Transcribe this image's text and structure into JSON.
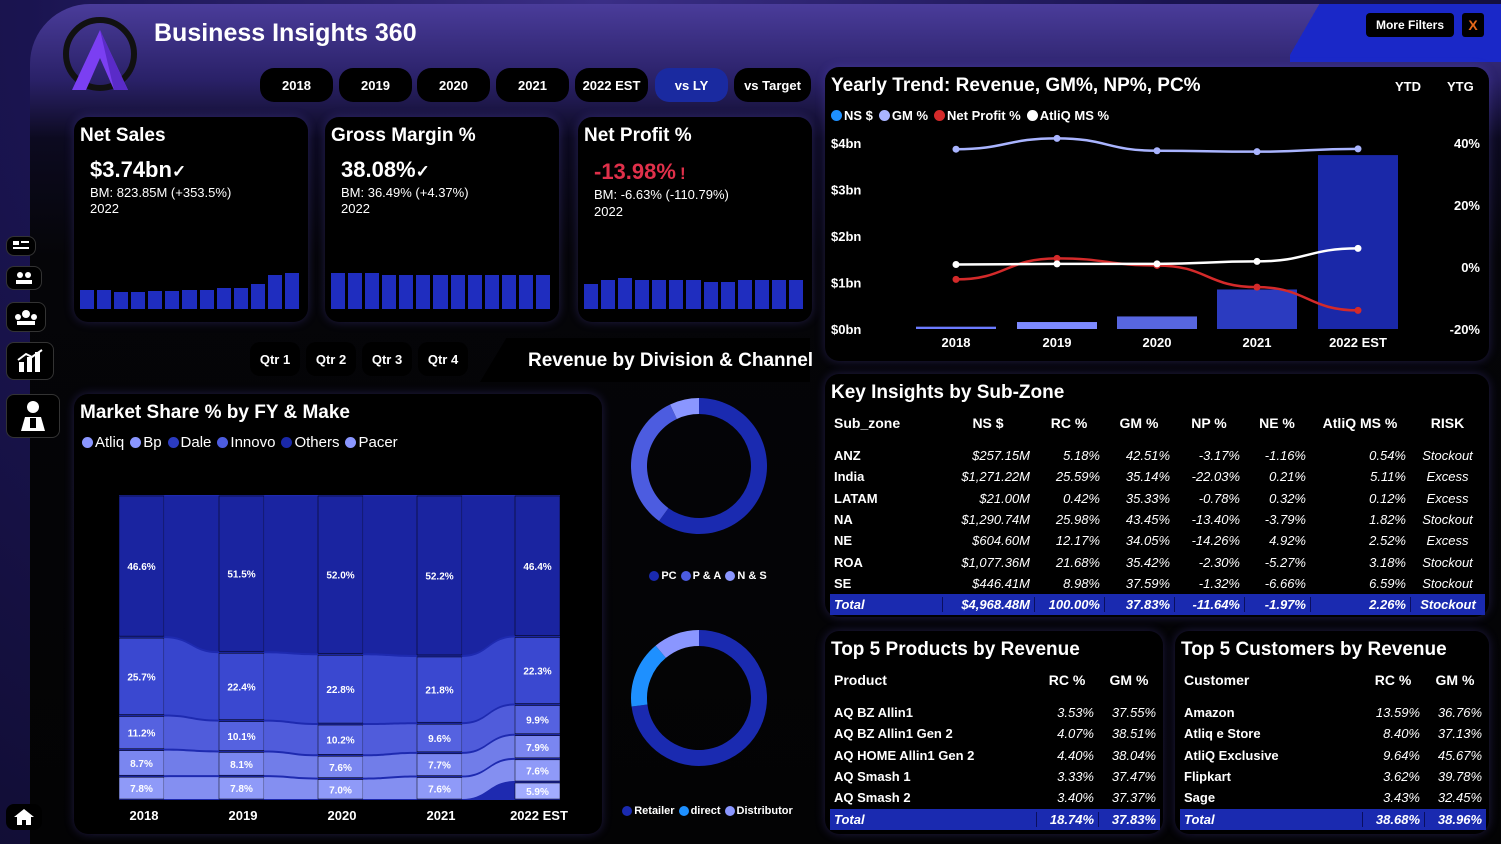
{
  "app": {
    "title": "Business Insights 360"
  },
  "header": {
    "more_filters": "More Filters",
    "close": "X"
  },
  "years": [
    "2018",
    "2019",
    "2020",
    "2021",
    "2022 EST"
  ],
  "compare": {
    "vs_ly": "vs LY",
    "vs_target": "vs Target"
  },
  "quarters": [
    "Qtr 1",
    "Qtr 2",
    "Qtr 3",
    "Qtr 4"
  ],
  "kpis": {
    "net_sales": {
      "title": "Net Sales",
      "value": "$3.74bn",
      "mark": "✓",
      "bm": "BM: 823.85M (+353.5%)",
      "year": "2022",
      "bars": [
        0.45,
        0.45,
        0.4,
        0.4,
        0.42,
        0.42,
        0.45,
        0.45,
        0.5,
        0.5,
        0.6,
        0.8,
        0.85
      ]
    },
    "gross_margin": {
      "title": "Gross Margin %",
      "value": "38.08%",
      "mark": "✓",
      "bm": "BM: 36.49% (+4.37%)",
      "year": "2022",
      "bars": [
        0.85,
        0.85,
        0.85,
        0.82,
        0.82,
        0.82,
        0.82,
        0.82,
        0.82,
        0.82,
        0.82,
        0.82,
        0.82
      ]
    },
    "net_profit": {
      "title": "Net Profit %",
      "value": "-13.98%",
      "mark": "!",
      "bm": "BM: -6.63% (-110.79%)",
      "year": "2022",
      "bars": [
        0.6,
        0.7,
        0.75,
        0.7,
        0.7,
        0.7,
        0.7,
        0.65,
        0.65,
        0.7,
        0.7,
        0.7,
        0.7
      ]
    }
  },
  "trend": {
    "title": "Yearly Trend: Revenue, GM%, NP%, PC%",
    "ytd": "YTD",
    "ytg": "YTG",
    "legend": [
      {
        "label": "NS $",
        "color": "#1e90ff"
      },
      {
        "label": "GM %",
        "color": "#a9b4ff"
      },
      {
        "label": "Net Profit %",
        "color": "#d42a2a"
      },
      {
        "label": "AtliQ MS %",
        "color": "#ffffff"
      }
    ],
    "left_ticks": [
      "$4bn",
      "$3bn",
      "$2bn",
      "$1bn",
      "$0bn"
    ],
    "right_ticks": [
      "40%",
      "20%",
      "0%",
      "-20%"
    ]
  },
  "chart_data": {
    "type": "bar",
    "categories": [
      "2018",
      "2019",
      "2020",
      "2021",
      "2022 EST"
    ],
    "ylim": [
      0,
      4
    ],
    "y2lim": [
      -20,
      40
    ],
    "series": [
      {
        "name": "NS $",
        "type": "bar",
        "values": [
          0.05,
          0.15,
          0.27,
          0.85,
          3.74
        ],
        "colors": [
          "#6c7bff",
          "#7d8aff",
          "#5766e0",
          "#2b3bc0",
          "#1a28a8"
        ]
      },
      {
        "name": "GM %",
        "type": "line",
        "color": "#a9b4ff",
        "values": [
          38.0,
          41.5,
          37.5,
          37.2,
          38.1
        ]
      },
      {
        "name": "Net Profit %",
        "type": "line",
        "color": "#d42a2a",
        "values": [
          -4.0,
          2.8,
          0.5,
          -6.5,
          -14.0
        ]
      },
      {
        "name": "AtliQ MS %",
        "type": "line",
        "color": "#ffffff",
        "values": [
          0.8,
          1.0,
          1.0,
          1.8,
          6.0
        ]
      }
    ]
  },
  "division": {
    "title": "Revenue by Division & Channel",
    "legend1": [
      {
        "label": "PC",
        "color": "#1a2ab0"
      },
      {
        "label": "P & A",
        "color": "#4c5ce0"
      },
      {
        "label": "N & S",
        "color": "#8a96ff"
      }
    ],
    "legend2": [
      {
        "label": "Retailer",
        "color": "#1a2ab0"
      },
      {
        "label": "direct",
        "color": "#1e90ff"
      },
      {
        "label": "Distributor",
        "color": "#8a96ff"
      }
    ],
    "donut1": [
      0.6,
      0.33,
      0.07
    ],
    "donut2": [
      0.73,
      0.16,
      0.11
    ]
  },
  "market_share": {
    "title": "Market Share % by FY & Make",
    "legend": [
      {
        "label": "Atliq",
        "color": "#8a96ff"
      },
      {
        "label": "Bp",
        "color": "#8a96ff"
      },
      {
        "label": "Dale",
        "color": "#2b3bc0"
      },
      {
        "label": "Innovo",
        "color": "#4c5ce0"
      },
      {
        "label": "Others",
        "color": "#1a28a8"
      },
      {
        "label": "Pacer",
        "color": "#8a96ff"
      }
    ],
    "years": [
      "2018",
      "2019",
      "2020",
      "2021",
      "2022 EST"
    ],
    "stacks": [
      [
        "46.6%",
        "25.7%",
        "11.2%",
        "8.7%",
        "7.8%"
      ],
      [
        "51.5%",
        "22.4%",
        "10.1%",
        "8.1%",
        "7.8%"
      ],
      [
        "52.0%",
        "22.8%",
        "10.2%",
        "7.6%",
        "7.0%"
      ],
      [
        "52.2%",
        "21.8%",
        "9.6%",
        "7.7%",
        "7.6%"
      ],
      [
        "46.4%",
        "22.3%",
        "9.9%",
        "7.9%",
        "7.6%",
        "5.9%"
      ]
    ]
  },
  "sub_zone": {
    "title": "Key Insights by Sub-Zone",
    "headers": [
      "Sub_zone",
      "NS $",
      "RC %",
      "GM %",
      "NP %",
      "NE %",
      "AtliQ MS %",
      "RISK"
    ],
    "rows": [
      [
        "ANZ",
        "$257.15M",
        "5.18%",
        "42.51%",
        "-3.17%",
        "-1.16%",
        "0.54%",
        "Stockout"
      ],
      [
        "India",
        "$1,271.22M",
        "25.59%",
        "35.14%",
        "-22.03%",
        "0.21%",
        "5.11%",
        "Excess"
      ],
      [
        "LATAM",
        "$21.00M",
        "0.42%",
        "35.33%",
        "-0.78%",
        "0.32%",
        "0.12%",
        "Excess"
      ],
      [
        "NA",
        "$1,290.74M",
        "25.98%",
        "43.45%",
        "-13.40%",
        "-3.79%",
        "1.82%",
        "Stockout"
      ],
      [
        "NE",
        "$604.60M",
        "12.17%",
        "34.05%",
        "-14.26%",
        "4.92%",
        "2.52%",
        "Excess"
      ],
      [
        "ROA",
        "$1,077.36M",
        "21.68%",
        "35.42%",
        "-2.30%",
        "-5.27%",
        "3.18%",
        "Stockout"
      ],
      [
        "SE",
        "$446.41M",
        "8.98%",
        "37.59%",
        "-1.32%",
        "-6.66%",
        "6.59%",
        "Stockout"
      ]
    ],
    "total": [
      "Total",
      "$4,968.48M",
      "100.00%",
      "37.83%",
      "-11.64%",
      "-1.97%",
      "2.26%",
      "Stockout"
    ]
  },
  "products": {
    "title": "Top 5 Products by Revenue",
    "headers": [
      "Product",
      "RC %",
      "GM %"
    ],
    "rows": [
      [
        "AQ BZ Allin1",
        "3.53%",
        "37.55%"
      ],
      [
        "AQ BZ Allin1 Gen 2",
        "4.07%",
        "38.51%"
      ],
      [
        "AQ HOME Allin1 Gen 2",
        "4.40%",
        "38.04%"
      ],
      [
        "AQ Smash 1",
        "3.33%",
        "37.47%"
      ],
      [
        "AQ Smash 2",
        "3.40%",
        "37.37%"
      ]
    ],
    "total": [
      "Total",
      "18.74%",
      "37.83%"
    ]
  },
  "customers": {
    "title": "Top 5 Customers by Revenue",
    "headers": [
      "Customer",
      "RC %",
      "GM %"
    ],
    "rows": [
      [
        "Amazon",
        "13.59%",
        "36.76%"
      ],
      [
        "Atliq e Store",
        "8.40%",
        "37.13%"
      ],
      [
        "AtliQ Exclusive",
        "9.64%",
        "45.67%"
      ],
      [
        "Flipkart",
        "3.62%",
        "39.78%"
      ],
      [
        "Sage",
        "3.43%",
        "32.45%"
      ]
    ],
    "total": [
      "Total",
      "38.68%",
      "38.96%"
    ]
  },
  "sidebar": {
    "icons": [
      "finance-view-icon",
      "sales-view-icon",
      "marketing-view-icon",
      "supply-chain-icon",
      "executive-view-icon",
      "home-icon"
    ]
  }
}
